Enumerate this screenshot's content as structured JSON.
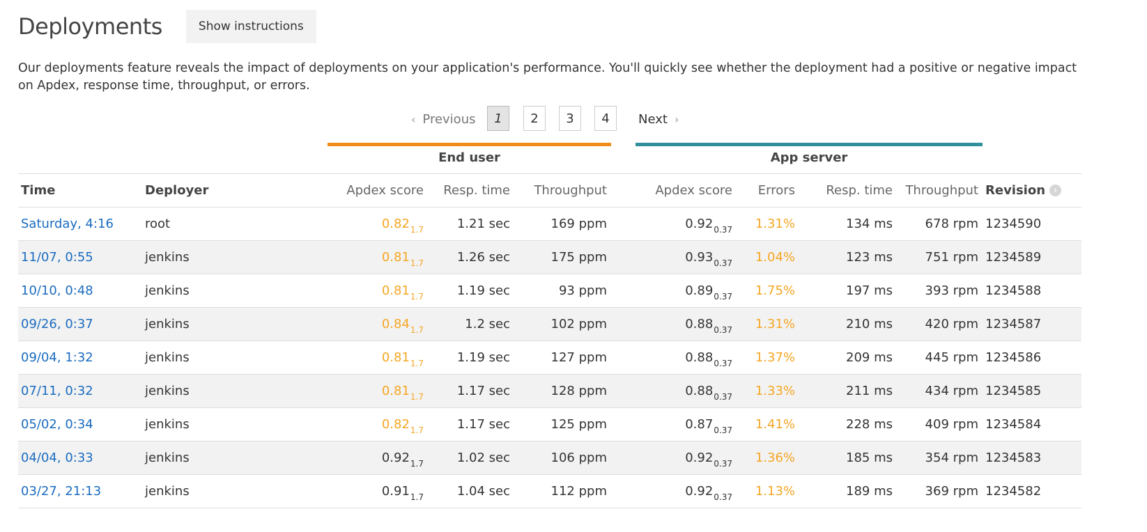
{
  "header": {
    "title": "Deployments",
    "instructions_button": "Show instructions"
  },
  "intro": "Our deployments feature reveals the impact of deployments on your application's performance. You'll quickly see whether the deployment had a positive or negative impact on Apdex, response time, throughput, or errors.",
  "pagination": {
    "previous": "Previous",
    "next": "Next",
    "pages": [
      "1",
      "2",
      "3",
      "4"
    ],
    "current": "1"
  },
  "groups": {
    "end_user": "End user",
    "app_server": "App server"
  },
  "columns": {
    "time": "Time",
    "deployer": "Deployer",
    "eu_apdex": "Apdex score",
    "eu_resp": "Resp. time",
    "eu_throughput": "Throughput",
    "as_apdex": "Apdex score",
    "as_errors": "Errors",
    "as_resp": "Resp. time",
    "as_throughput": "Throughput",
    "revision": "Revision"
  },
  "colors": {
    "end_user_bar": "#f08c1c",
    "app_server_bar": "#2f8f9a",
    "link": "#1a6bbf",
    "warning": "#f5a623"
  },
  "icons": {
    "revision_sort": "chevron-right-circle-icon",
    "prev": "chevron-left-icon",
    "next": "chevron-right-icon"
  },
  "rows": [
    {
      "time": "Saturday, 4:16",
      "deployer": "root",
      "eu_apdex": "0.82",
      "eu_apdex_t": "1.7",
      "eu_apdex_warn": true,
      "eu_resp": "1.21 sec",
      "eu_throughput": "169 ppm",
      "as_apdex": "0.92",
      "as_apdex_t": "0.37",
      "as_errors": "1.31%",
      "as_resp": "134 ms",
      "as_throughput": "678 rpm",
      "revision": "1234590"
    },
    {
      "time": "11/07, 0:55",
      "deployer": "jenkins",
      "eu_apdex": "0.81",
      "eu_apdex_t": "1.7",
      "eu_apdex_warn": true,
      "eu_resp": "1.26 sec",
      "eu_throughput": "175 ppm",
      "as_apdex": "0.93",
      "as_apdex_t": "0.37",
      "as_errors": "1.04%",
      "as_resp": "123 ms",
      "as_throughput": "751 rpm",
      "revision": "1234589"
    },
    {
      "time": "10/10, 0:48",
      "deployer": "jenkins",
      "eu_apdex": "0.81",
      "eu_apdex_t": "1.7",
      "eu_apdex_warn": true,
      "eu_resp": "1.19 sec",
      "eu_throughput": "93 ppm",
      "as_apdex": "0.89",
      "as_apdex_t": "0.37",
      "as_errors": "1.75%",
      "as_resp": "197 ms",
      "as_throughput": "393 rpm",
      "revision": "1234588"
    },
    {
      "time": "09/26, 0:37",
      "deployer": "jenkins",
      "eu_apdex": "0.84",
      "eu_apdex_t": "1.7",
      "eu_apdex_warn": true,
      "eu_resp": "1.2 sec",
      "eu_throughput": "102 ppm",
      "as_apdex": "0.88",
      "as_apdex_t": "0.37",
      "as_errors": "1.31%",
      "as_resp": "210 ms",
      "as_throughput": "420 rpm",
      "revision": "1234587"
    },
    {
      "time": "09/04, 1:32",
      "deployer": "jenkins",
      "eu_apdex": "0.81",
      "eu_apdex_t": "1.7",
      "eu_apdex_warn": true,
      "eu_resp": "1.19 sec",
      "eu_throughput": "127 ppm",
      "as_apdex": "0.88",
      "as_apdex_t": "0.37",
      "as_errors": "1.37%",
      "as_resp": "209 ms",
      "as_throughput": "445 rpm",
      "revision": "1234586"
    },
    {
      "time": "07/11, 0:32",
      "deployer": "jenkins",
      "eu_apdex": "0.81",
      "eu_apdex_t": "1.7",
      "eu_apdex_warn": true,
      "eu_resp": "1.17 sec",
      "eu_throughput": "128 ppm",
      "as_apdex": "0.88",
      "as_apdex_t": "0.37",
      "as_errors": "1.33%",
      "as_resp": "211 ms",
      "as_throughput": "434 rpm",
      "revision": "1234585"
    },
    {
      "time": "05/02, 0:34",
      "deployer": "jenkins",
      "eu_apdex": "0.82",
      "eu_apdex_t": "1.7",
      "eu_apdex_warn": true,
      "eu_resp": "1.17 sec",
      "eu_throughput": "125 ppm",
      "as_apdex": "0.87",
      "as_apdex_t": "0.37",
      "as_errors": "1.41%",
      "as_resp": "228 ms",
      "as_throughput": "409 rpm",
      "revision": "1234584"
    },
    {
      "time": "04/04, 0:33",
      "deployer": "jenkins",
      "eu_apdex": "0.92",
      "eu_apdex_t": "1.7",
      "eu_apdex_warn": false,
      "eu_resp": "1.02 sec",
      "eu_throughput": "106 ppm",
      "as_apdex": "0.92",
      "as_apdex_t": "0.37",
      "as_errors": "1.36%",
      "as_resp": "185 ms",
      "as_throughput": "354 rpm",
      "revision": "1234583"
    },
    {
      "time": "03/27, 21:13",
      "deployer": "jenkins",
      "eu_apdex": "0.91",
      "eu_apdex_t": "1.7",
      "eu_apdex_warn": false,
      "eu_resp": "1.04 sec",
      "eu_throughput": "112 ppm",
      "as_apdex": "0.92",
      "as_apdex_t": "0.37",
      "as_errors": "1.13%",
      "as_resp": "189 ms",
      "as_throughput": "369 rpm",
      "revision": "1234582"
    }
  ]
}
